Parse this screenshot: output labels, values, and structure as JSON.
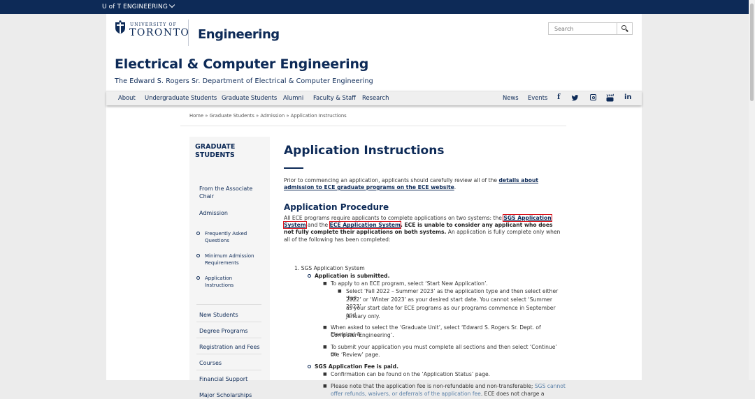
{
  "topbar": {
    "brand": "U of T ENGINEERING"
  },
  "header": {
    "uoft_small": "UNIVERSITY OF",
    "uoft_big": "TORONTO",
    "engineering": "Engineering",
    "search_placeholder": "Search"
  },
  "dept": {
    "title": "Electrical & Computer Engineering",
    "subtitle": "The Edward S. Rogers Sr. Department of Electrical & Computer Engineering"
  },
  "nav": {
    "left": [
      "About",
      "Undergraduate Students",
      "Graduate Students",
      "Alumni",
      "Faculty & Staff",
      "Research"
    ],
    "right": [
      "News",
      "Events"
    ],
    "social": [
      "f",
      "youtube",
      "in"
    ]
  },
  "breadcrumb": {
    "home": "Home",
    "grad": "Graduate Students",
    "admission": "Admission",
    "current": "Application Instructions",
    "sep": " » "
  },
  "sidebar": {
    "heading_1": "GRADUATE",
    "heading_2": "STUDENTS",
    "assoc_1": "From the Associate",
    "assoc_2": "Chair",
    "admission": "Admission",
    "sub": [
      {
        "l1": "Frequently Asked",
        "l2": "Questions"
      },
      {
        "l1": "Minimum Admission",
        "l2": "Requirements"
      },
      {
        "l1": "Application",
        "l2": "Instructions"
      }
    ],
    "links": [
      "New Students",
      "Degree Programs",
      "Registration and Fees",
      "Courses",
      "Financial Support",
      "Major Scholarships"
    ]
  },
  "content": {
    "title": "Application Instructions",
    "intro_a": "Prior to commencing an application, applicants should carefully review all of the ",
    "intro_link": "details about admission to ECE graduate programs on the ECE website",
    "intro_b": ".",
    "procedure_heading": "Application Procedure",
    "proc_a": "All ECE programs require applicants to complete applications on two systems: the ",
    "sgs_link": "SGS Application System",
    "proc_and": " and the ",
    "ece_link": "ECE Application System",
    "proc_bold": ". ECE is unable to consider any applicant who does not fully complete their applications on both systems.",
    "proc_b": " An application is fully complete only when all of the following has been completed:",
    "list_1": "1. SGS Application System",
    "submitted": "Application is submitted.",
    "apply_ece": "To apply to an ECE program, select ‘Start New Application’.",
    "select_fall": [
      "Select ‘Fall 2022 – Summer 2023’ as the application type and then select either ‘Fall",
      "2022’ or ‘Winter 2023’ as your desired start date. You cannot select ‘Summer 2023’",
      "as your start date for ECE programs as our programs commence in September and",
      "January only."
    ],
    "grad_unit": [
      "When asked to select the ‘Graduate Unit’, select ‘Edward S. Rogers Sr. Dept. of Electrical &",
      "Computer Engineering’."
    ],
    "submit": [
      "To submit your application you must complete all sections and then select ‘Continue’ on",
      "the ‘Review’ page."
    ],
    "fee_paid": "SGS Application Fee is paid.",
    "confirmation": "Confirmation can be found on the ‘Application Status’ page.",
    "fee_note_a": "Please note that the application fee is non-refundable and non-transferable; ",
    "fee_note_link": "SGS cannot",
    "fee_note_l2a": "offer refunds, waivers, or deferrals of the application fee",
    "fee_note_l2b": ". ECE does not charge a"
  }
}
